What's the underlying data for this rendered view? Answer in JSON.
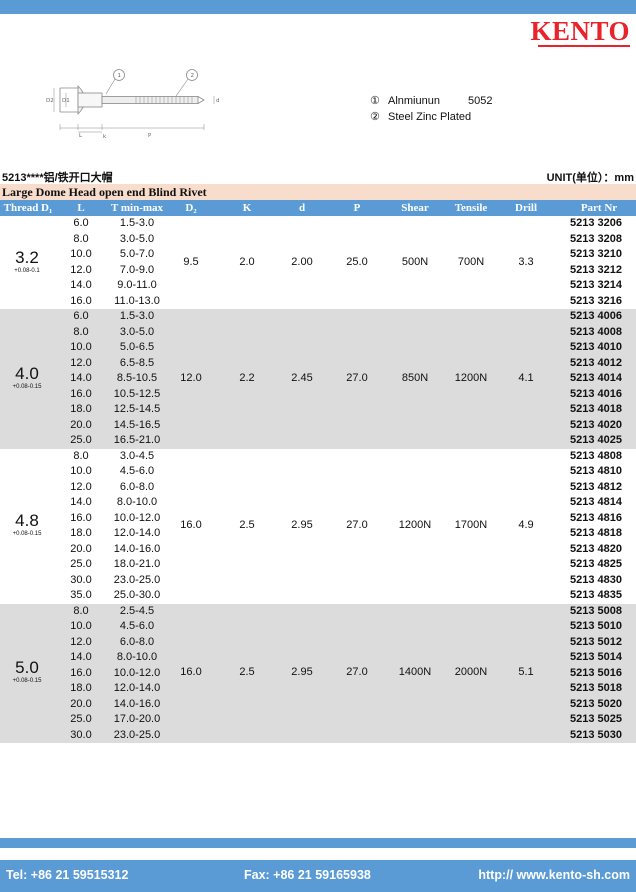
{
  "brand": {
    "name": "KENTO",
    "color": "#e8232a"
  },
  "accent_color": "#5b9bd5",
  "diagram": {
    "callouts": [
      "1",
      "2"
    ],
    "dim_labels": [
      "D2",
      "D1",
      "d",
      "L",
      "k",
      "P"
    ]
  },
  "materials": [
    {
      "marker": "①",
      "name": "Alnmiunun",
      "grade": "5052"
    },
    {
      "marker": "②",
      "name": "Steel Zinc Plated",
      "grade": ""
    }
  ],
  "series": "5213****铝/铁开口大帽",
  "unit": "UNIT(单位）：mm",
  "table_title": "Large Dome Head open end Blind Rivet",
  "headers": [
    "Thread D₁",
    "L",
    "T min-max",
    "D₂",
    "K",
    "d",
    "P",
    "Shear",
    "Tensile",
    "Drill",
    "Part Nr"
  ],
  "groups": [
    {
      "thread": "3.2",
      "tol": "+0.08-0.1",
      "d2": "9.5",
      "k": "2.0",
      "d": "2.00",
      "p": "25.0",
      "shear": "500N",
      "tensile": "700N",
      "drill": "3.3",
      "rows": [
        [
          "6.0",
          "1.5-3.0",
          "5213 3206"
        ],
        [
          "8.0",
          "3.0-5.0",
          "5213 3208"
        ],
        [
          "10.0",
          "5.0-7.0",
          "5213 3210"
        ],
        [
          "12.0",
          "7.0-9.0",
          "5213 3212"
        ],
        [
          "14.0",
          "9.0-11.0",
          "5213 3214"
        ],
        [
          "16.0",
          "11.0-13.0",
          "5213 3216"
        ]
      ]
    },
    {
      "thread": "4.0",
      "tol": "+0.08-0.15",
      "d2": "12.0",
      "k": "2.2",
      "d": "2.45",
      "p": "27.0",
      "shear": "850N",
      "tensile": "1200N",
      "drill": "4.1",
      "rows": [
        [
          "6.0",
          "1.5-3.0",
          "5213 4006"
        ],
        [
          "8.0",
          "3.0-5.0",
          "5213 4008"
        ],
        [
          "10.0",
          "5.0-6.5",
          "5213 4010"
        ],
        [
          "12.0",
          "6.5-8.5",
          "5213 4012"
        ],
        [
          "14.0",
          "8.5-10.5",
          "5213 4014"
        ],
        [
          "16.0",
          "10.5-12.5",
          "5213 4016"
        ],
        [
          "18.0",
          "12.5-14.5",
          "5213 4018"
        ],
        [
          "20.0",
          "14.5-16.5",
          "5213 4020"
        ],
        [
          "25.0",
          "16.5-21.0",
          "5213 4025"
        ]
      ]
    },
    {
      "thread": "4.8",
      "tol": "+0.08-0.15",
      "d2": "16.0",
      "k": "2.5",
      "d": "2.95",
      "p": "27.0",
      "shear": "1200N",
      "tensile": "1700N",
      "drill": "4.9",
      "rows": [
        [
          "8.0",
          "3.0-4.5",
          "5213 4808"
        ],
        [
          "10.0",
          "4.5-6.0",
          "5213 4810"
        ],
        [
          "12.0",
          "6.0-8.0",
          "5213 4812"
        ],
        [
          "14.0",
          "8.0-10.0",
          "5213 4814"
        ],
        [
          "16.0",
          "10.0-12.0",
          "5213 4816"
        ],
        [
          "18.0",
          "12.0-14.0",
          "5213 4818"
        ],
        [
          "20.0",
          "14.0-16.0",
          "5213 4820"
        ],
        [
          "25.0",
          "18.0-21.0",
          "5213 4825"
        ],
        [
          "30.0",
          "23.0-25.0",
          "5213 4830"
        ],
        [
          "35.0",
          "25.0-30.0",
          "5213 4835"
        ]
      ]
    },
    {
      "thread": "5.0",
      "tol": "+0.08-0.15",
      "d2": "16.0",
      "k": "2.5",
      "d": "2.95",
      "p": "27.0",
      "shear": "1400N",
      "tensile": "2000N",
      "drill": "5.1",
      "rows": [
        [
          "8.0",
          "2.5-4.5",
          "5213 5008"
        ],
        [
          "10.0",
          "4.5-6.0",
          "5213 5010"
        ],
        [
          "12.0",
          "6.0-8.0",
          "5213 5012"
        ],
        [
          "14.0",
          "8.0-10.0",
          "5213 5014"
        ],
        [
          "16.0",
          "10.0-12.0",
          "5213 5016"
        ],
        [
          "18.0",
          "12.0-14.0",
          "5213 5018"
        ],
        [
          "20.0",
          "14.0-16.0",
          "5213 5020"
        ],
        [
          "25.0",
          "17.0-20.0",
          "5213 5025"
        ],
        [
          "30.0",
          "23.0-25.0",
          "5213 5030"
        ]
      ]
    }
  ],
  "footer": {
    "tel": "Tel: +86 21 59515312",
    "fax": "Fax: +86 21 59165938",
    "web": "http:// www.kento-sh.com"
  }
}
